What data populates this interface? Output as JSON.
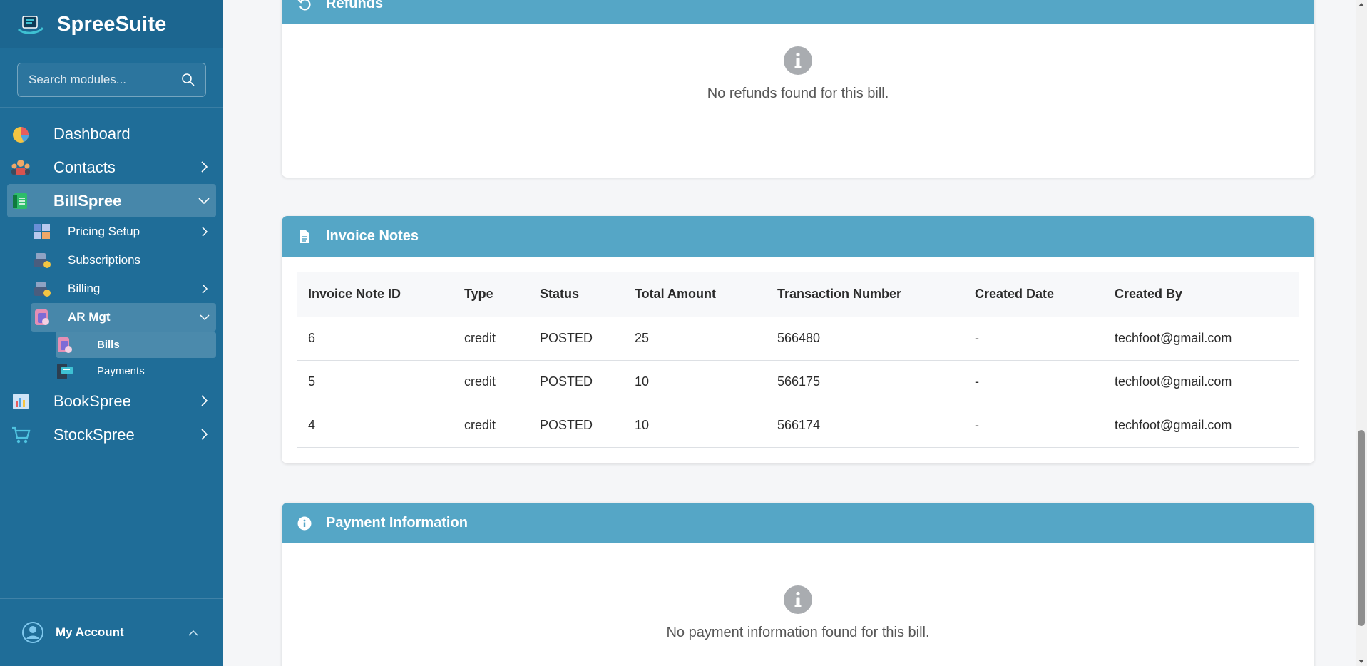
{
  "app": {
    "name": "SpreeSuite",
    "logo_icon": "spreesuite-logo"
  },
  "search": {
    "placeholder": "Search modules..."
  },
  "nav": {
    "dashboard": "Dashboard",
    "contacts": "Contacts",
    "billspree": "BillSpree",
    "pricing_setup": "Pricing Setup",
    "subscriptions": "Subscriptions",
    "billing": "Billing",
    "ar_mgt": "AR Mgt",
    "bills": "Bills",
    "payments": "Payments",
    "bookspree": "BookSpree",
    "stockspree": "StockSpree"
  },
  "account": {
    "label": "My Account"
  },
  "refunds": {
    "title": "Refunds",
    "empty_message": "No refunds found for this bill."
  },
  "invoice_notes": {
    "title": "Invoice Notes",
    "columns": [
      "Invoice Note ID",
      "Type",
      "Status",
      "Total Amount",
      "Transaction Number",
      "Created Date",
      "Created By"
    ],
    "rows": [
      [
        "6",
        "credit",
        "POSTED",
        "25",
        "566480",
        "-",
        "techfoot@gmail.com"
      ],
      [
        "5",
        "credit",
        "POSTED",
        "10",
        "566175",
        "-",
        "techfoot@gmail.com"
      ],
      [
        "4",
        "credit",
        "POSTED",
        "10",
        "566174",
        "-",
        "techfoot@gmail.com"
      ]
    ]
  },
  "payment_info": {
    "title": "Payment Information",
    "empty_message": "No payment information found for this bill."
  },
  "colors": {
    "sidebar": "#1f6d98",
    "card_header": "#55a6c6",
    "empty_icon": "#a9acb0"
  }
}
